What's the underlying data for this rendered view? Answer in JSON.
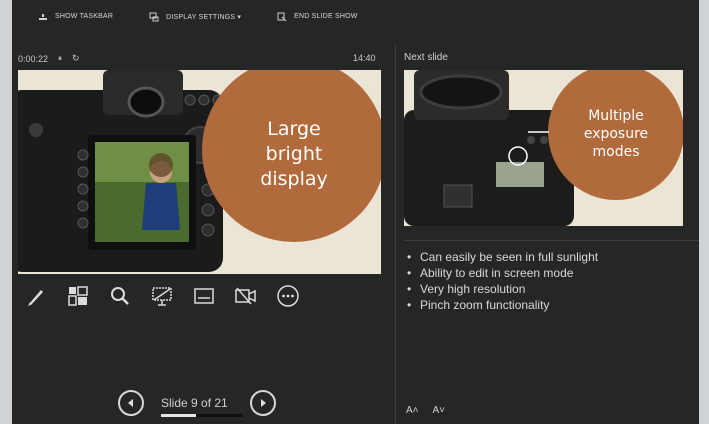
{
  "toolbar": {
    "show_taskbar": "SHOW TASKBAR",
    "display_settings": "DISPLAY SETTINGS ▾",
    "end_slide_show": "END SLIDE SHOW"
  },
  "presenter": {
    "elapsed_time": "0:00:22",
    "pause_label": "⏸",
    "reset_label": "↻",
    "clock": "14:40"
  },
  "current_slide": {
    "text_lines": [
      "Large",
      "bright",
      "display"
    ]
  },
  "next_slide": {
    "label": "Next slide",
    "text_lines": [
      "Multiple",
      "exposure",
      "modes"
    ]
  },
  "notes": [
    "Can easily be seen in full sunlight",
    "Ability to edit in screen mode",
    "Very high resolution",
    "Pinch zoom functionality"
  ],
  "navigation": {
    "slide_counter": "Slide 9 of 21",
    "progress_fraction": 0.43
  },
  "font_controls": {
    "increase": "A˄",
    "decrease": "A˅"
  },
  "tools": [
    "pen-icon",
    "see-all-slides-icon",
    "zoom-icon",
    "black-screen-icon",
    "subtitles-icon",
    "camera-off-icon",
    "more-options-icon"
  ],
  "colors": {
    "background": "#262626",
    "slide_circle": "#b06a3c",
    "slide_backdrop": "#ebe5d6",
    "text": "#d9d9d9"
  }
}
